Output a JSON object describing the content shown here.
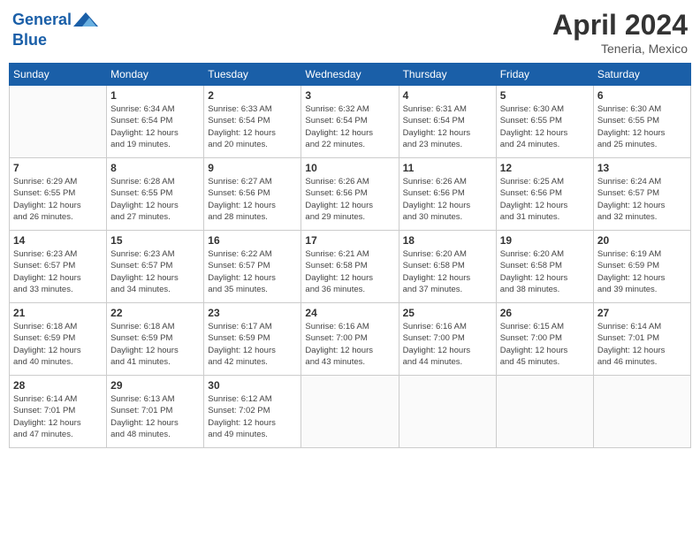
{
  "header": {
    "logo_line1": "General",
    "logo_line2": "Blue",
    "month_year": "April 2024",
    "location": "Teneria, Mexico"
  },
  "days_of_week": [
    "Sunday",
    "Monday",
    "Tuesday",
    "Wednesday",
    "Thursday",
    "Friday",
    "Saturday"
  ],
  "weeks": [
    [
      {
        "day": "",
        "sunrise": "",
        "sunset": "",
        "daylight": ""
      },
      {
        "day": "1",
        "sunrise": "6:34 AM",
        "sunset": "6:54 PM",
        "daylight": "12 hours and 19 minutes."
      },
      {
        "day": "2",
        "sunrise": "6:33 AM",
        "sunset": "6:54 PM",
        "daylight": "12 hours and 20 minutes."
      },
      {
        "day": "3",
        "sunrise": "6:32 AM",
        "sunset": "6:54 PM",
        "daylight": "12 hours and 22 minutes."
      },
      {
        "day": "4",
        "sunrise": "6:31 AM",
        "sunset": "6:54 PM",
        "daylight": "12 hours and 23 minutes."
      },
      {
        "day": "5",
        "sunrise": "6:30 AM",
        "sunset": "6:55 PM",
        "daylight": "12 hours and 24 minutes."
      },
      {
        "day": "6",
        "sunrise": "6:30 AM",
        "sunset": "6:55 PM",
        "daylight": "12 hours and 25 minutes."
      }
    ],
    [
      {
        "day": "7",
        "sunrise": "6:29 AM",
        "sunset": "6:55 PM",
        "daylight": "12 hours and 26 minutes."
      },
      {
        "day": "8",
        "sunrise": "6:28 AM",
        "sunset": "6:55 PM",
        "daylight": "12 hours and 27 minutes."
      },
      {
        "day": "9",
        "sunrise": "6:27 AM",
        "sunset": "6:56 PM",
        "daylight": "12 hours and 28 minutes."
      },
      {
        "day": "10",
        "sunrise": "6:26 AM",
        "sunset": "6:56 PM",
        "daylight": "12 hours and 29 minutes."
      },
      {
        "day": "11",
        "sunrise": "6:26 AM",
        "sunset": "6:56 PM",
        "daylight": "12 hours and 30 minutes."
      },
      {
        "day": "12",
        "sunrise": "6:25 AM",
        "sunset": "6:56 PM",
        "daylight": "12 hours and 31 minutes."
      },
      {
        "day": "13",
        "sunrise": "6:24 AM",
        "sunset": "6:57 PM",
        "daylight": "12 hours and 32 minutes."
      }
    ],
    [
      {
        "day": "14",
        "sunrise": "6:23 AM",
        "sunset": "6:57 PM",
        "daylight": "12 hours and 33 minutes."
      },
      {
        "day": "15",
        "sunrise": "6:23 AM",
        "sunset": "6:57 PM",
        "daylight": "12 hours and 34 minutes."
      },
      {
        "day": "16",
        "sunrise": "6:22 AM",
        "sunset": "6:57 PM",
        "daylight": "12 hours and 35 minutes."
      },
      {
        "day": "17",
        "sunrise": "6:21 AM",
        "sunset": "6:58 PM",
        "daylight": "12 hours and 36 minutes."
      },
      {
        "day": "18",
        "sunrise": "6:20 AM",
        "sunset": "6:58 PM",
        "daylight": "12 hours and 37 minutes."
      },
      {
        "day": "19",
        "sunrise": "6:20 AM",
        "sunset": "6:58 PM",
        "daylight": "12 hours and 38 minutes."
      },
      {
        "day": "20",
        "sunrise": "6:19 AM",
        "sunset": "6:59 PM",
        "daylight": "12 hours and 39 minutes."
      }
    ],
    [
      {
        "day": "21",
        "sunrise": "6:18 AM",
        "sunset": "6:59 PM",
        "daylight": "12 hours and 40 minutes."
      },
      {
        "day": "22",
        "sunrise": "6:18 AM",
        "sunset": "6:59 PM",
        "daylight": "12 hours and 41 minutes."
      },
      {
        "day": "23",
        "sunrise": "6:17 AM",
        "sunset": "6:59 PM",
        "daylight": "12 hours and 42 minutes."
      },
      {
        "day": "24",
        "sunrise": "6:16 AM",
        "sunset": "7:00 PM",
        "daylight": "12 hours and 43 minutes."
      },
      {
        "day": "25",
        "sunrise": "6:16 AM",
        "sunset": "7:00 PM",
        "daylight": "12 hours and 44 minutes."
      },
      {
        "day": "26",
        "sunrise": "6:15 AM",
        "sunset": "7:00 PM",
        "daylight": "12 hours and 45 minutes."
      },
      {
        "day": "27",
        "sunrise": "6:14 AM",
        "sunset": "7:01 PM",
        "daylight": "12 hours and 46 minutes."
      }
    ],
    [
      {
        "day": "28",
        "sunrise": "6:14 AM",
        "sunset": "7:01 PM",
        "daylight": "12 hours and 47 minutes."
      },
      {
        "day": "29",
        "sunrise": "6:13 AM",
        "sunset": "7:01 PM",
        "daylight": "12 hours and 48 minutes."
      },
      {
        "day": "30",
        "sunrise": "6:12 AM",
        "sunset": "7:02 PM",
        "daylight": "12 hours and 49 minutes."
      },
      {
        "day": "",
        "sunrise": "",
        "sunset": "",
        "daylight": ""
      },
      {
        "day": "",
        "sunrise": "",
        "sunset": "",
        "daylight": ""
      },
      {
        "day": "",
        "sunrise": "",
        "sunset": "",
        "daylight": ""
      },
      {
        "day": "",
        "sunrise": "",
        "sunset": "",
        "daylight": ""
      }
    ]
  ],
  "labels": {
    "sunrise_prefix": "Sunrise: ",
    "sunset_prefix": "Sunset: ",
    "daylight_prefix": "Daylight: "
  }
}
